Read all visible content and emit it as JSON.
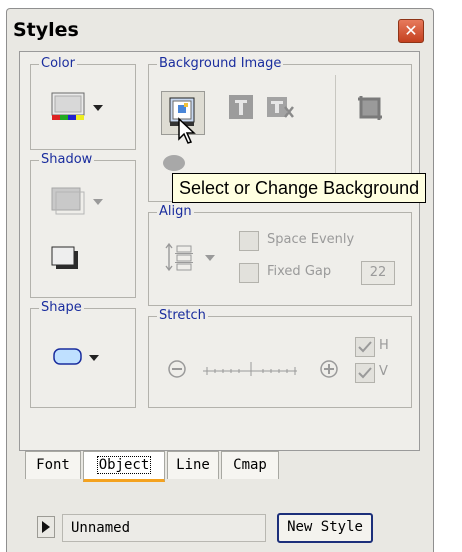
{
  "window": {
    "title": "Styles",
    "close_label": "x"
  },
  "groups": {
    "color": "Color",
    "shadow": "Shadow",
    "shape": "Shape",
    "background_image": "Background Image",
    "align": "Align",
    "stretch": "Stretch"
  },
  "align": {
    "space_evenly": "Space Evenly",
    "fixed_gap": "Fixed Gap",
    "gap_value": "22"
  },
  "stretch": {
    "h_label": "H",
    "v_label": "V"
  },
  "tooltip": "Select or Change Background",
  "tabs": [
    {
      "label": "Font"
    },
    {
      "label": "Object"
    },
    {
      "label": "Line"
    },
    {
      "label": "Cmap"
    }
  ],
  "footer": {
    "style_name": "Unnamed",
    "new_style": "New Style"
  },
  "colors": {
    "legend_text": "#1a2d9e",
    "tab_highlight": "#f4a21f",
    "tooltip_bg": "#ffffe1"
  }
}
